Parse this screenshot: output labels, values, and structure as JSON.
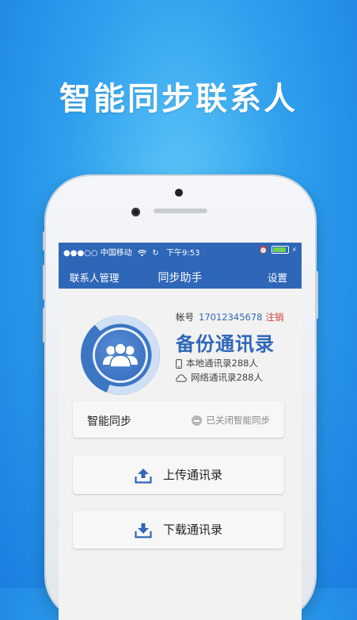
{
  "headline": "智能同步联系人",
  "statusbar": {
    "carrier": "●●●○○ 中国移动",
    "wifi_icon": "wifi-icon",
    "sync_icon": "↻",
    "time": "下午9:53",
    "alarm_icon": "⏰",
    "battery_level": 0.85,
    "charging_icon": "⚡"
  },
  "nav": {
    "left": "联系人管理",
    "title": "同步助手",
    "right": "设置"
  },
  "account": {
    "label": "帐号",
    "number": "17012345678",
    "logout": "注销"
  },
  "backup_title": "备份通讯录",
  "stats": {
    "local": "本地通讯录288人",
    "cloud": "网络通讯录288人"
  },
  "smart_sync": {
    "label": "智能同步",
    "status": "已关闭智能同步"
  },
  "actions": {
    "upload": "上传通讯录",
    "download": "下载通讯录"
  },
  "colors": {
    "brand_blue": "#2f67b8",
    "logout_red": "#d23b35",
    "background_blue": "#2f9fee"
  }
}
